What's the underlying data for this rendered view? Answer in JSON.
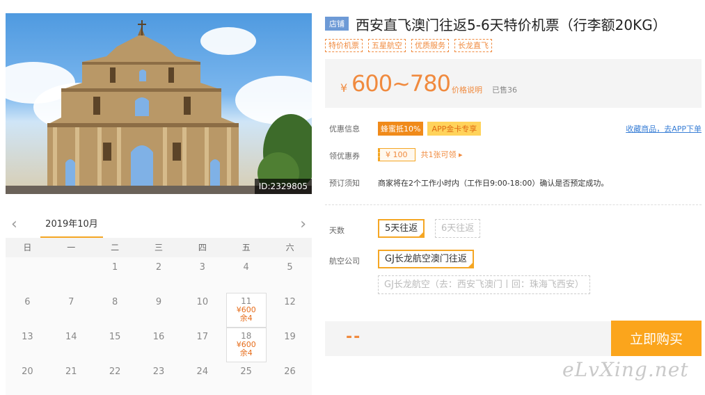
{
  "photo": {
    "id_label": "ID:2329805"
  },
  "calendar": {
    "month": "2019年10月",
    "prev_icon": "chevron-left-icon",
    "next_icon": "chevron-right-icon",
    "weekdays": [
      "日",
      "一",
      "二",
      "三",
      "四",
      "五",
      "六"
    ],
    "weeks": [
      [
        "",
        "",
        "1",
        "2",
        "3",
        "4",
        "5"
      ],
      [
        "6",
        "7",
        "8",
        "9",
        "10",
        "11",
        "12"
      ],
      [
        "13",
        "14",
        "15",
        "16",
        "17",
        "18",
        "19"
      ],
      [
        "20",
        "21",
        "22",
        "23",
        "24",
        "25",
        "26"
      ]
    ],
    "priced_days": [
      {
        "day": "11",
        "price": "¥600",
        "remaining": "余4"
      },
      {
        "day": "18",
        "price": "¥600",
        "remaining": "余4"
      }
    ]
  },
  "product": {
    "shop_badge": "店铺",
    "title": "西安直飞澳门往返5-6天特价机票（行李额20KG）",
    "tags": [
      "特价机票",
      "五星航空",
      "优质服务",
      "长龙直飞"
    ],
    "price_currency": "¥",
    "price_range": "600~780",
    "price_explain": "价格说明",
    "sold": "已售36"
  },
  "info": {
    "discount_label": "优惠信息",
    "discount_badge": "蜂蜜抵10%",
    "app_badge": "APP金卡专享",
    "favorite_link": "收藏商品，去APP下单",
    "coupon_label": "领优惠券",
    "coupon_value": "¥ 100",
    "coupon_count": "共1张可领 ▸",
    "notice_label": "预订须知",
    "notice_text": "商家将在2个工作小时内（工作日9:00-18:00）确认是否预定成功。"
  },
  "options": {
    "days_label": "天数",
    "days": [
      {
        "label": "5天往返",
        "state": "selected"
      },
      {
        "label": "6天往返",
        "state": "disabled"
      }
    ],
    "airline_label": "航空公司",
    "airlines": [
      {
        "label": "GJ长龙航空澳门往返",
        "state": "selected"
      },
      {
        "label": "GJ长龙航空（去：西安飞澳门丨回：珠海飞西安）",
        "state": "disabled"
      }
    ]
  },
  "buy": {
    "total_placeholder": "--",
    "button": "立即购买"
  },
  "watermark": "eLvXing.net",
  "colors": {
    "accent": "#f5a623",
    "price": "#f08a3e",
    "link": "#3a7fd6",
    "shop_badge": "#6d9ad6"
  }
}
